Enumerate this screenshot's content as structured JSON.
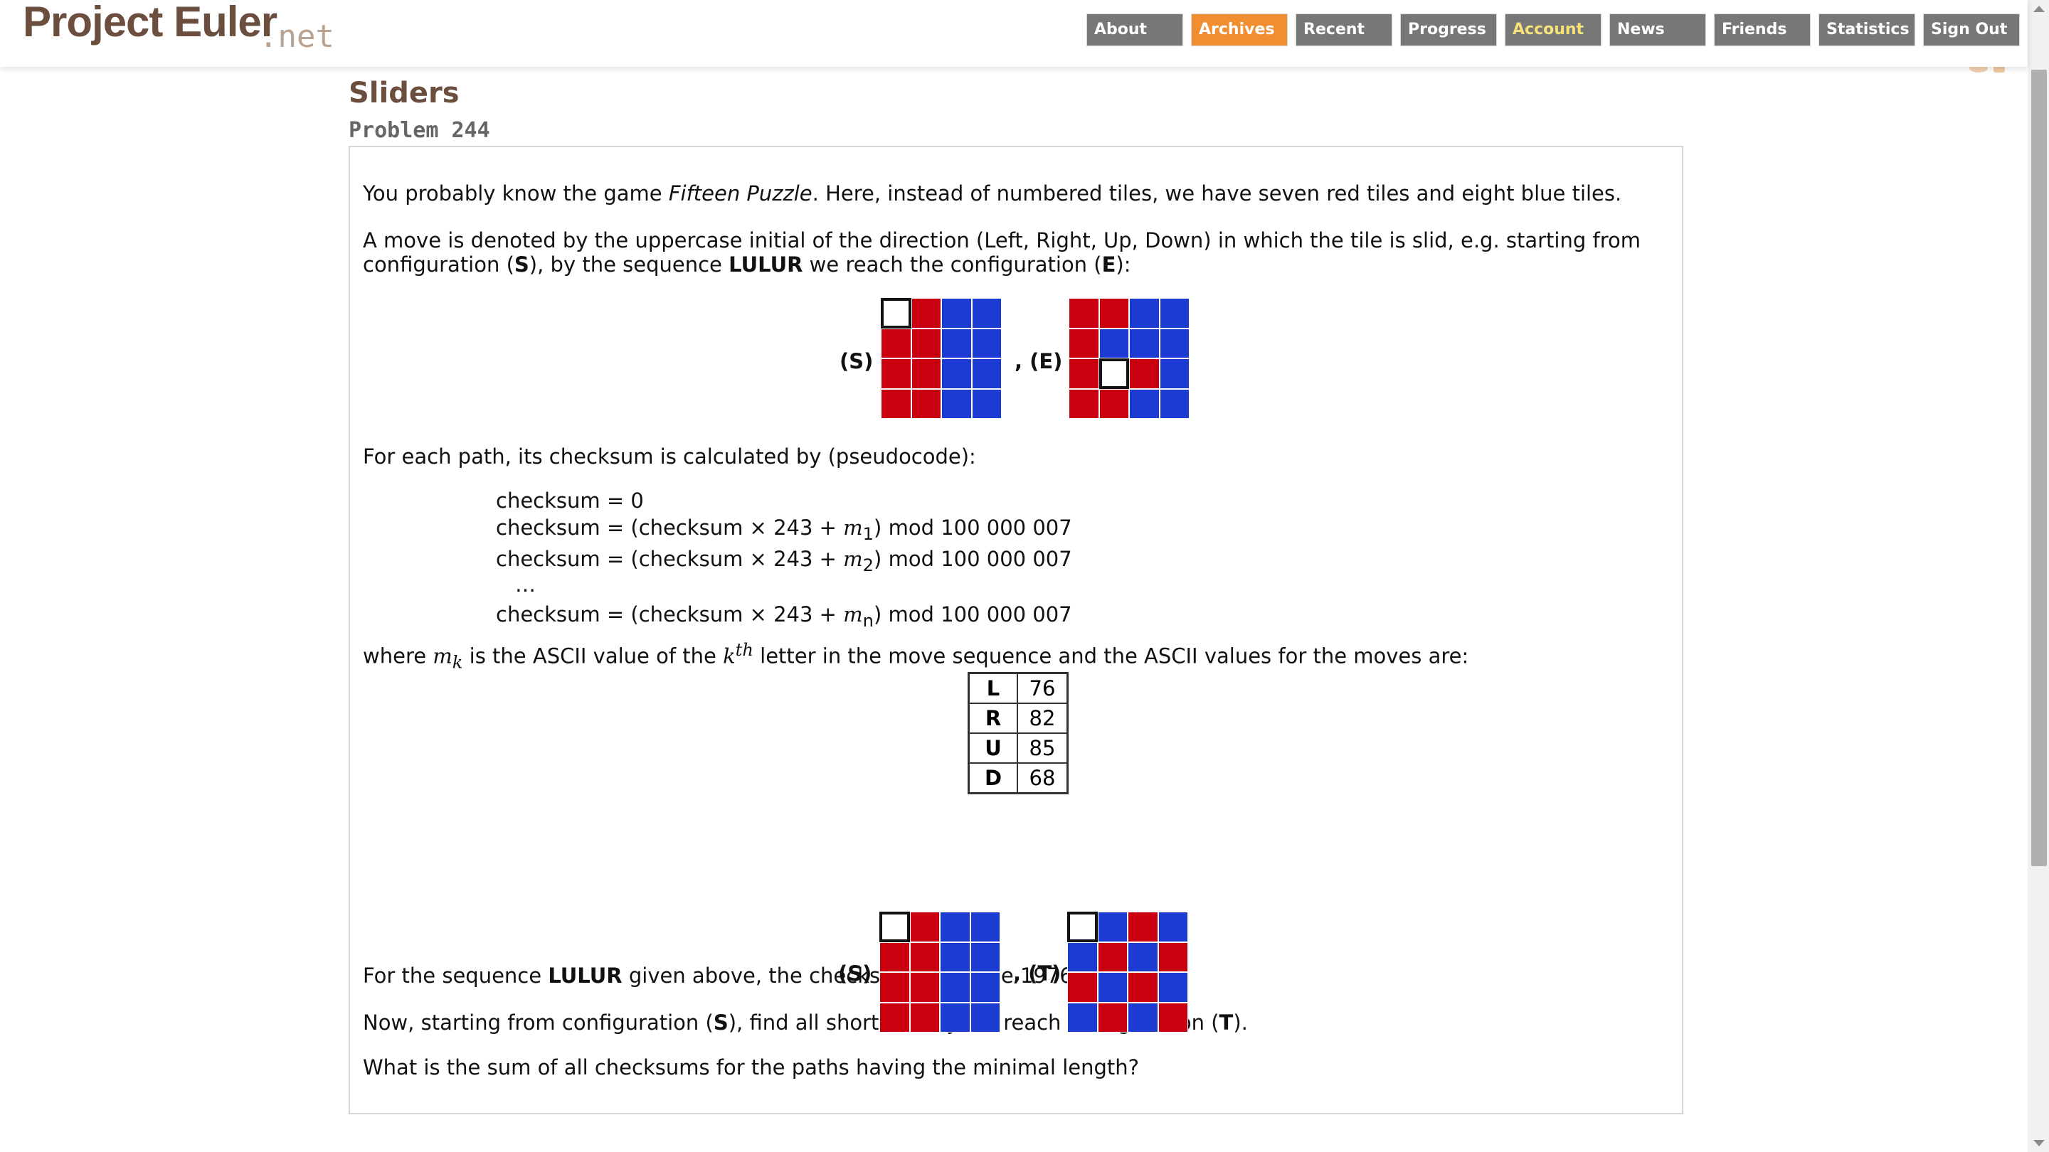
{
  "site": {
    "logo_main": "Project Euler",
    "logo_net": ".net"
  },
  "nav": {
    "items": [
      {
        "label": "About"
      },
      {
        "label": "Archives"
      },
      {
        "label": "Recent"
      },
      {
        "label": "Progress"
      },
      {
        "label": "Account"
      },
      {
        "label": "News"
      },
      {
        "label": "Friends"
      },
      {
        "label": "Statistics"
      },
      {
        "label": "Sign Out"
      }
    ]
  },
  "problem": {
    "title": "Sliders",
    "number_label": "Problem 244",
    "intro_pre": "You probably know the game ",
    "intro_game": "Fifteen Puzzle",
    "intro_post": ". Here, instead of numbered tiles, we have seven red tiles and eight blue tiles.",
    "move_line1": "A move is denoted by the uppercase initial of the direction (Left, Right, Up, Down) in which the tile is slid, e.g. starting from",
    "move_line2_a": "configuration (",
    "move_line2_s": "S",
    "move_line2_b": "), by the sequence ",
    "move_line2_seq": "LULUR",
    "move_line2_c": " we reach the configuration (",
    "move_line2_e": "E",
    "move_line2_d": "):",
    "label_S": "(S)",
    "label_E": ", (E)",
    "label_T": ", (T)",
    "checksum_intro": "For each path, its checksum is calculated by (pseudocode):",
    "code_lines": [
      "checksum = 0",
      "checksum = (checksum × 243 + ",
      "checksum = (checksum × 243 + ",
      "…",
      "checksum = (checksum × 243 + "
    ],
    "code_vars": [
      "m",
      "1",
      "m",
      "2",
      "m",
      "n"
    ],
    "code_tail": ") mod 100 000 007",
    "where_pre": "where ",
    "where_var": "m",
    "where_sub": "k",
    "where_mid": " is the ASCII value of the ",
    "where_k": "k",
    "where_th": "th",
    "where_post": " letter in the move sequence and the ASCII values for the moves are:",
    "ascii_table": [
      {
        "move": "L",
        "value": "76"
      },
      {
        "move": "R",
        "value": "82"
      },
      {
        "move": "U",
        "value": "85"
      },
      {
        "move": "D",
        "value": "68"
      }
    ],
    "lulur_pre": "For the sequence ",
    "lulur_seq": "LULUR",
    "lulur_post": " given above, the checksum would be 19761398.",
    "now_pre": "Now, starting from configuration (",
    "now_s": "S",
    "now_mid": "), find all shortest ways to reach configuration (",
    "now_t": "T",
    "now_post": ").",
    "question": "What is the sum of all checksums for the paths having the minimal length?"
  },
  "grids": {
    "S": [
      "E",
      "R",
      "B",
      "B",
      "R",
      "R",
      "B",
      "B",
      "R",
      "R",
      "B",
      "B",
      "R",
      "R",
      "B",
      "B"
    ],
    "E": [
      "R",
      "R",
      "B",
      "B",
      "R",
      "B",
      "B",
      "B",
      "R",
      "E",
      "R",
      "B",
      "R",
      "R",
      "B",
      "B"
    ],
    "T": [
      "E",
      "B",
      "R",
      "B",
      "B",
      "R",
      "B",
      "R",
      "R",
      "B",
      "R",
      "B",
      "B",
      "R",
      "B",
      "R"
    ]
  },
  "colors": {
    "red": "#c8000f",
    "blue": "#1b3bd1",
    "brand_brown": "#6b4e3d",
    "nav_active": "#f28e32"
  }
}
